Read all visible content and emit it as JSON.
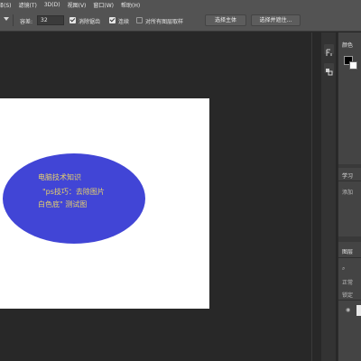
{
  "menu": [
    "择(S)",
    "滤镜(T)",
    "3D(D)",
    "视图(V)",
    "窗口(W)",
    "帮助(H)"
  ],
  "options": {
    "tolerance_label": "容差:",
    "tolerance_value": "32",
    "antialias_label": "消除锯齿",
    "contiguous_label": "连续",
    "sample_all_label": "对所有图层取样",
    "select_subject_button": "选择主体",
    "select_mask_button": "选择并遮住..."
  },
  "canvas": {
    "ellipse_color": "#4145d6",
    "text_color": "#e8d36a",
    "line1": "电脑技术知识",
    "line2": "\"ps技巧：去除图片",
    "line3": "白色底\" 测试图"
  },
  "panels": {
    "color_title": "颜色",
    "learn_title": "学习",
    "learn_add": "添加",
    "layers_title": "图层",
    "layers_normal": "正常",
    "layers_lock": "锁定"
  }
}
